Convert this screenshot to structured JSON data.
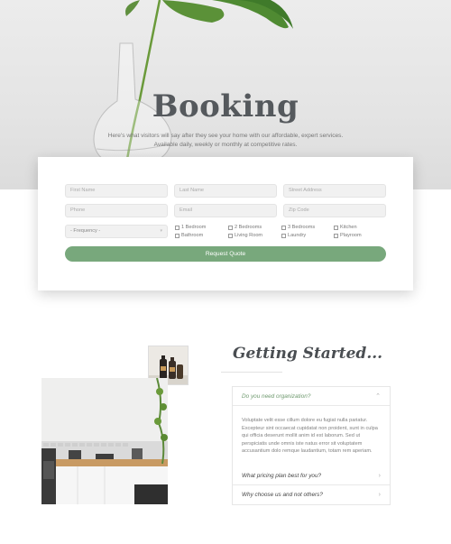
{
  "hero": {
    "title": "Booking",
    "subtitle_line1": "Here's what visitors will say after they see your home with our affordable, expert services.",
    "subtitle_line2": "Available daily, weekly or monthly at competitive rates."
  },
  "booking_form": {
    "fields": {
      "first_name": "First Name",
      "last_name": "Last Name",
      "street_address": "Street Address",
      "phone": "Phone",
      "email": "Email",
      "zip_code": "Zip Code"
    },
    "frequency_select": "- Frequency -",
    "rooms": [
      "1 Bedroom",
      "2 Bedrooms",
      "3 Bedrooms",
      "Kitchen",
      "Bathroom",
      "Living Room",
      "Laundry",
      "Playroom"
    ],
    "submit_label": "Request Quote"
  },
  "getting_started": {
    "title": "Getting Started...",
    "accordion": [
      {
        "question": "Do you need organization?",
        "answer": "Voluptate velit esse cillum dolore eu fugiat nulla pariatur. Excepteur sint occaecat cupidatat non proident, sunt in culpa qui officia deserunt mollit anim id est laborum. Sed ut perspiciatis unde omnis iste natus error sit voluptatem accusantium dolo remque laudantium, totam rem aperiam."
      },
      {
        "question": "What pricing plan best for you?"
      },
      {
        "question": "Why choose us and not others?"
      }
    ]
  },
  "colors": {
    "accent_green": "#78a87c",
    "title_gray": "#55595d",
    "active_question": "#6f9a6f"
  }
}
